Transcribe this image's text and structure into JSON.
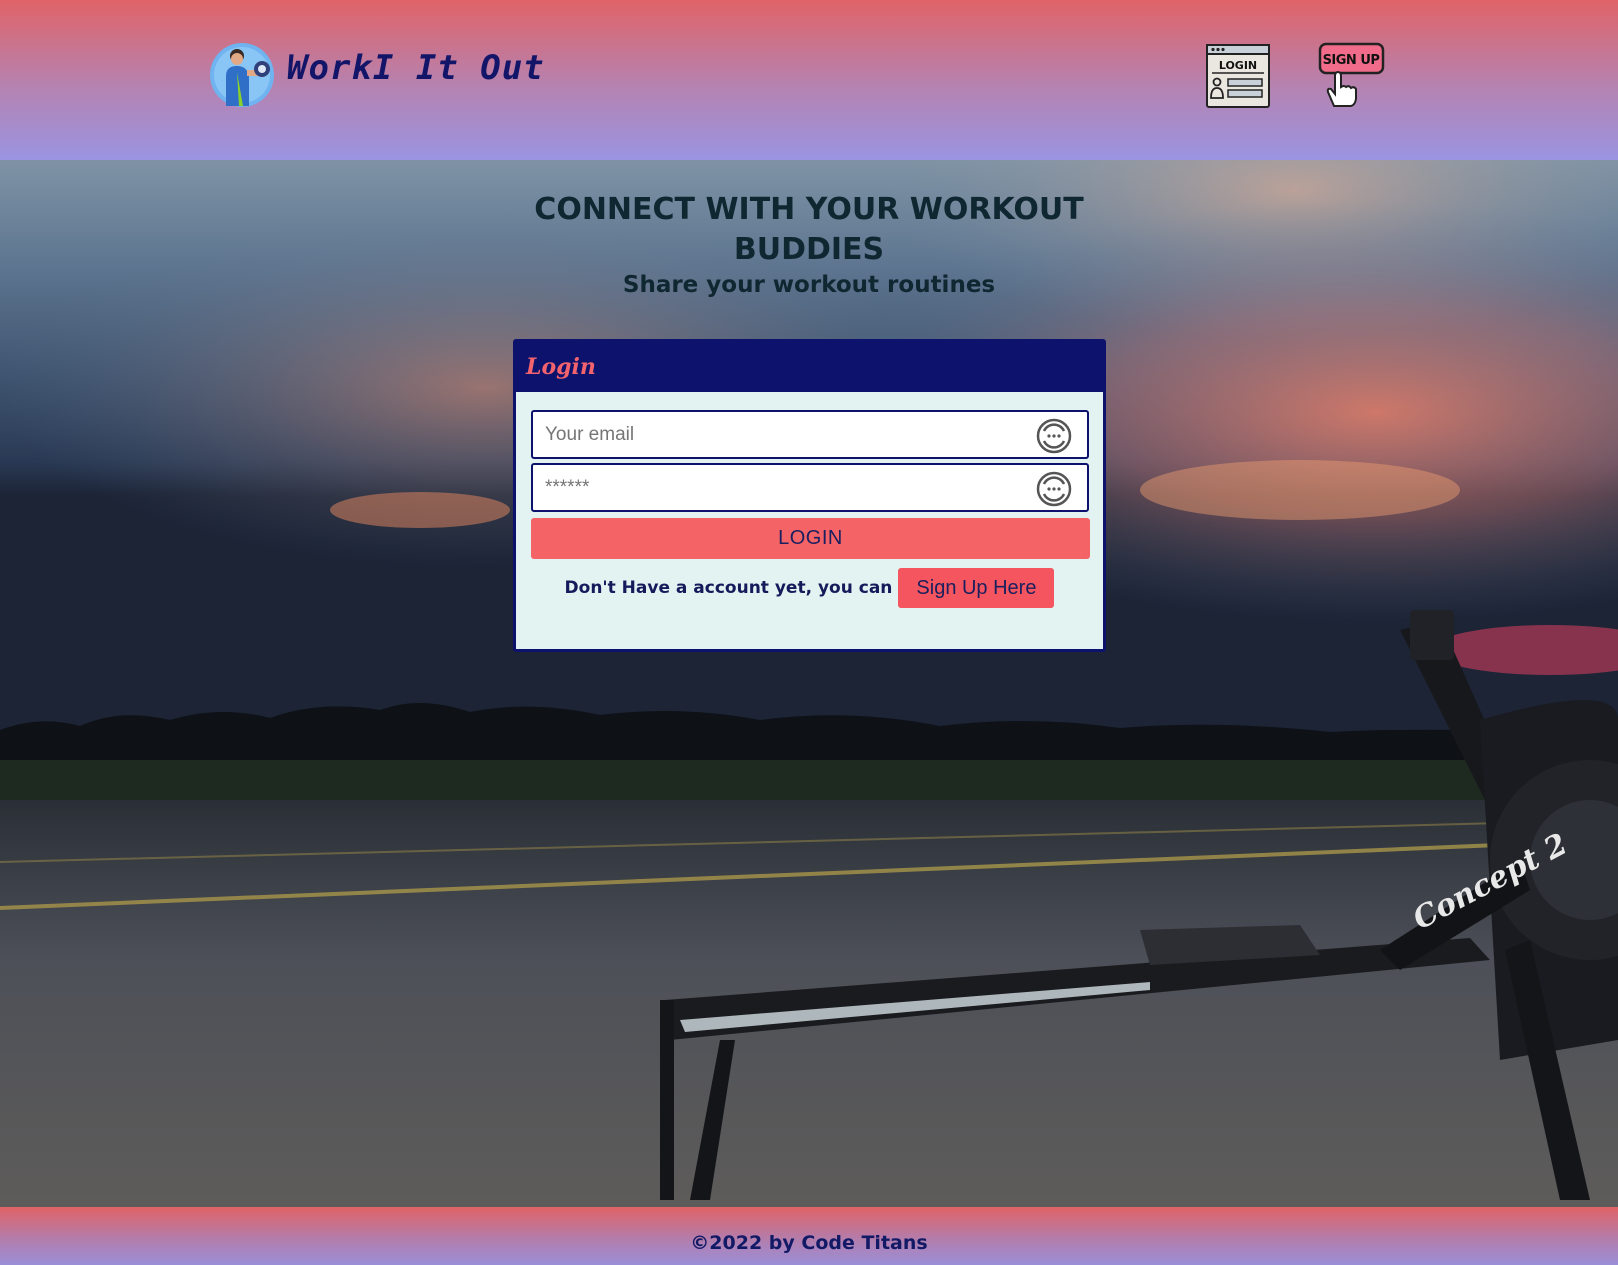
{
  "brand": {
    "name": "WorkI It Out"
  },
  "nav": {
    "login_icon_text": "LOGIN",
    "signup_icon_text": "SIGN UP"
  },
  "hero": {
    "headline": "CONNECT WITH YOUR WORKOUT BUDDIES",
    "subline": "Share your workout routines",
    "machine_label": "Concept 2"
  },
  "login_card": {
    "title": "Login",
    "email_placeholder": "Your email",
    "password_value": "******",
    "login_button": "LOGIN",
    "signup_prompt": "Don't Have a account yet, you can",
    "signup_button": "Sign Up Here"
  },
  "footer": {
    "text": "©2022 by Code Titans"
  },
  "colors": {
    "header_top": "#e06367",
    "header_bottom": "#9a94e2",
    "card_header": "#0d126c",
    "card_body": "#e2f3f2",
    "accent": "#f46366"
  }
}
